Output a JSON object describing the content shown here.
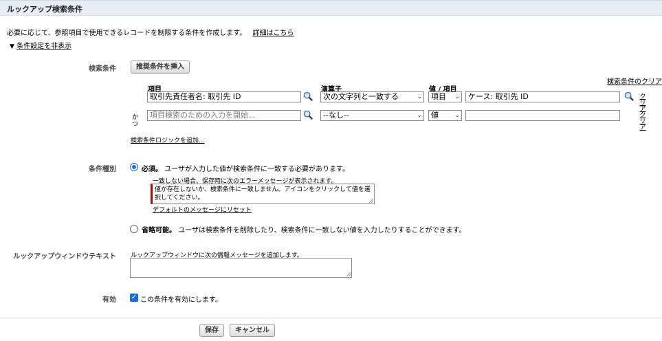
{
  "header": {
    "title": "ルックアップ検索条件"
  },
  "intro": {
    "text": "必要に応じて、参照項目で使用できるレコードを制限する条件を作成します。",
    "details_link": "詳細はこちら"
  },
  "toggle": {
    "label": "条件設定を非表示"
  },
  "filter": {
    "label": "検索条件",
    "insert_button": "推奨条件を挿入",
    "clear_link": "検索条件のクリア",
    "col_field": "項目",
    "col_operator": "演算子",
    "col_value": "値 / 項目",
    "and_label": "かつ",
    "rows": [
      {
        "field_value": "取引先責任者名: 取引先 ID",
        "operator": "次の文字列と一致する",
        "value_type": "項目",
        "value": "ケース: 取引先 ID",
        "clear": "クリア"
      },
      {
        "field_placeholder": "項目検索のための入力を開始...",
        "operator": "--なし--",
        "value_type": "値",
        "value": "",
        "clear": "クリア"
      }
    ],
    "add_logic_link": "検索条件ロジックを追加..."
  },
  "condition_type": {
    "label": "条件種別",
    "required_title": "必須。",
    "required_desc": "ユーザが入力した値が検索条件に一致する必要があります。",
    "mismatch_note": "一致しない場合、保存時に次のエラーメッセージが表示されます。",
    "error_message": "値が存在しないか、検索条件に一致しません。アイコンをクリックして値を選択してください。",
    "reset_link": "デフォルトのメッセージにリセット",
    "optional_title": "省略可能。",
    "optional_desc": "ユーザは検索条件を削除したり、検索条件に一致しない値を入力したりすることができます。"
  },
  "lookup_text": {
    "label": "ルックアップウィンドウテキスト",
    "desc": "ルックアップウィンドウに次の情報メッセージを追加します。",
    "value": ""
  },
  "active": {
    "label": "有効",
    "checkbox_label": "この条件を有効にします。"
  },
  "footer": {
    "save": "保存",
    "cancel": "キャンセル"
  },
  "colors": {
    "accent": "#1a6fd6",
    "error_bar": "#c00000",
    "header_bg": "#e8edf5"
  }
}
